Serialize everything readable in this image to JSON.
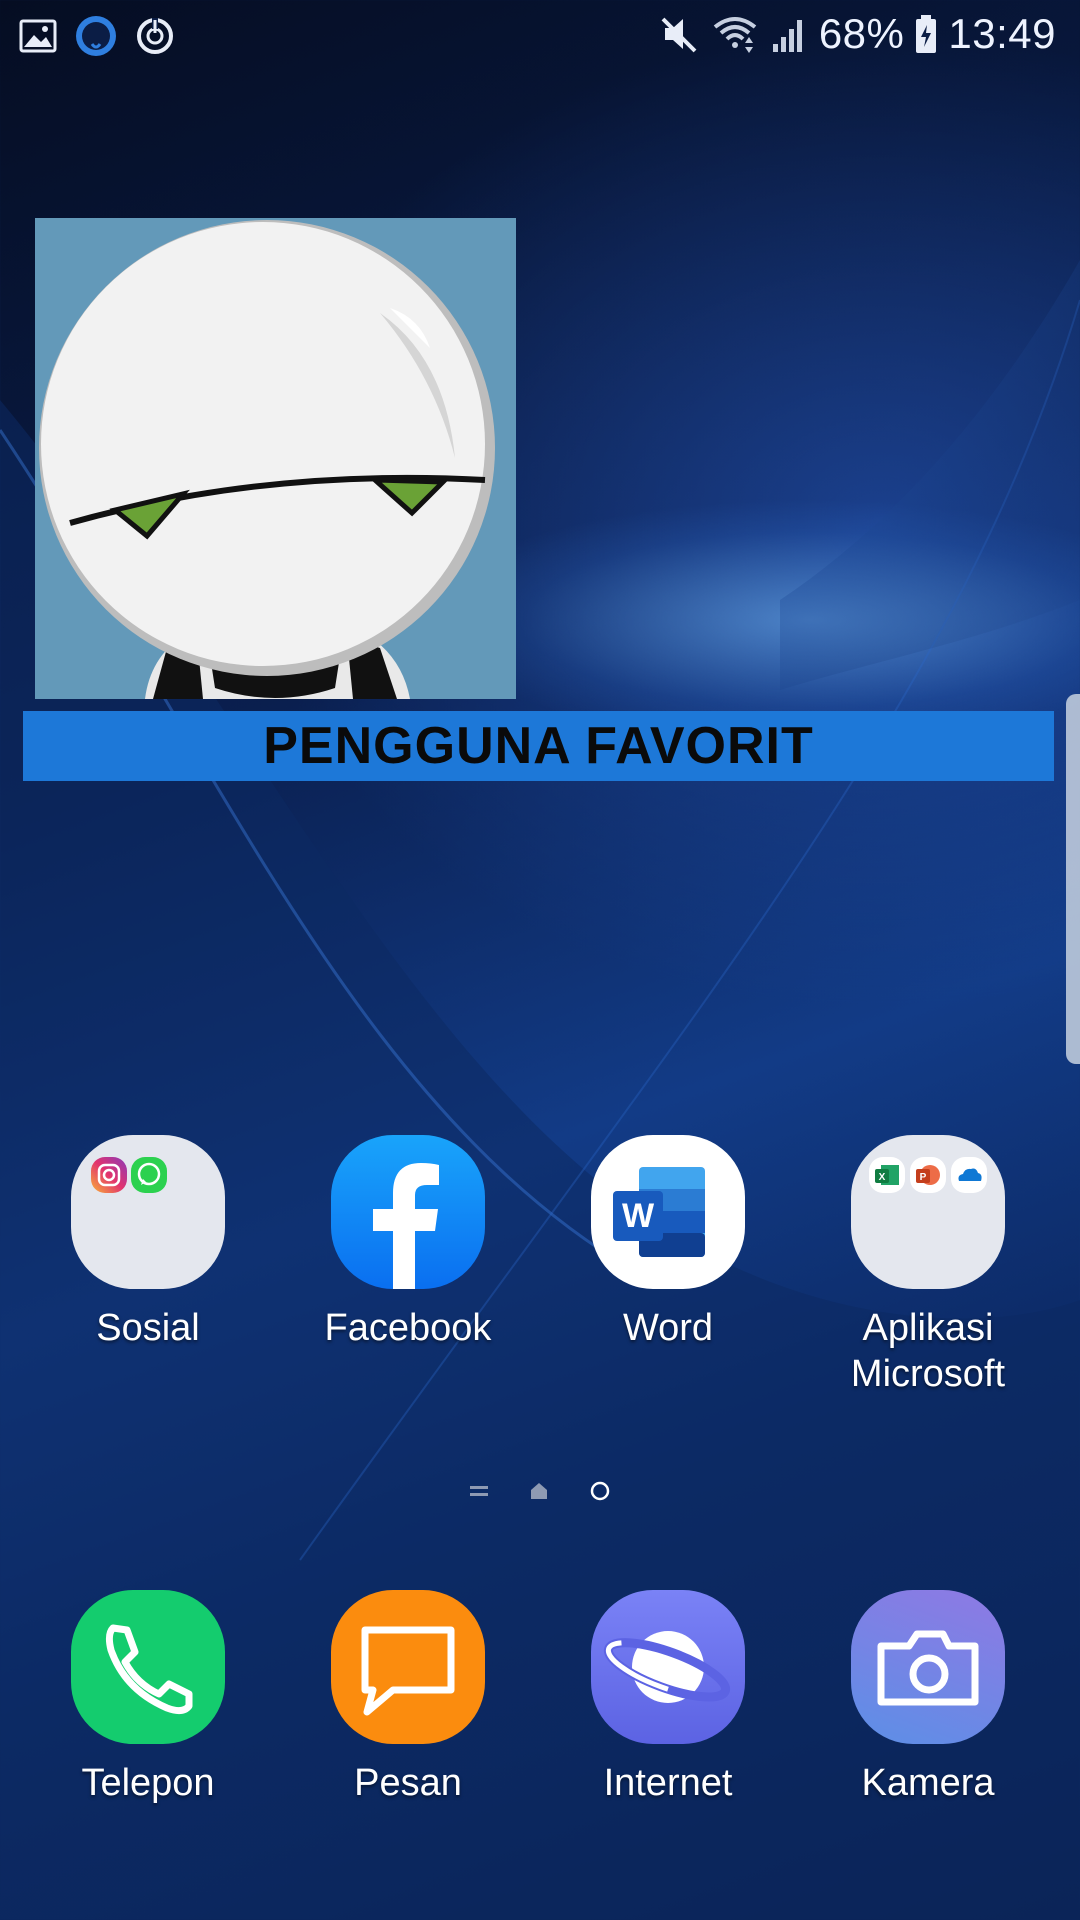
{
  "status_bar": {
    "left_icons": [
      "gallery-icon",
      "github-icon",
      "sync-icon"
    ],
    "right_icons": [
      "mute-icon",
      "wifi-icon",
      "signal-icon"
    ],
    "battery_percent": "68%",
    "time": "13:49"
  },
  "widget": {
    "banner_text": "PENGGUNA FAVORIT",
    "photo_description_icon": "robot-avatar-icon"
  },
  "apps": [
    {
      "label": "Sosial",
      "icon": "folder-icon",
      "contents": [
        "instagram-icon",
        "whatsapp-icon"
      ]
    },
    {
      "label": "Facebook",
      "icon": "facebook-icon"
    },
    {
      "label": "Word",
      "icon": "word-icon"
    },
    {
      "label": "Aplikasi\nMicrosoft",
      "icon": "folder-icon",
      "contents": [
        "excel-icon",
        "powerpoint-icon",
        "onedrive-icon"
      ]
    }
  ],
  "page_indicator": [
    "menu-page-icon",
    "home-page-icon",
    "current-page-icon"
  ],
  "dock": [
    {
      "label": "Telepon",
      "icon": "phone-icon",
      "color": "#14cc6e"
    },
    {
      "label": "Pesan",
      "icon": "message-icon",
      "color": "#fb8c0e"
    },
    {
      "label": "Internet",
      "icon": "internet-icon",
      "color": "#6a72ee"
    },
    {
      "label": "Kamera",
      "icon": "camera-icon",
      "color": "#7a7ce6"
    }
  ],
  "colors": {
    "banner": "#1d78d8",
    "photo_bg": "#6399b9",
    "folder_bg": "#e4e7ee"
  }
}
